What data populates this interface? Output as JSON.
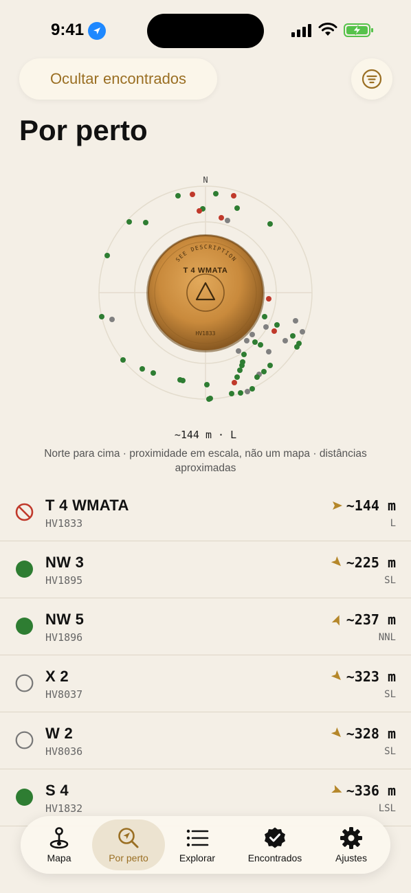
{
  "status_bar": {
    "time": "9:41"
  },
  "header": {
    "hide_found_label": "Ocultar encontrados",
    "title": "Por perto"
  },
  "radar": {
    "north_label": "N",
    "medallion_top_text": "SEE DESCRIPTION",
    "medallion_name": "T 4 WMATA",
    "medallion_code": "HV1833",
    "distance_summary": "~144 m · L",
    "note": "Norte para cima · proximidade em escala, não um mapa · distâncias aproximadas"
  },
  "list": [
    {
      "name": "T 4 WMATA",
      "code": "HV1833",
      "distance": "~144 m",
      "direction": "L",
      "status": "destroyed",
      "bearing": 90
    },
    {
      "name": "NW 3",
      "code": "HV1895",
      "distance": "~225 m",
      "direction": "SL",
      "status": "found",
      "bearing": 135
    },
    {
      "name": "NW 5",
      "code": "HV1896",
      "distance": "~237 m",
      "direction": "NNL",
      "status": "found",
      "bearing": 22
    },
    {
      "name": "X 2",
      "code": "HV8037",
      "distance": "~323 m",
      "direction": "SL",
      "status": "not-found",
      "bearing": 135
    },
    {
      "name": "W 2",
      "code": "HV8036",
      "distance": "~328 m",
      "direction": "SL",
      "status": "not-found",
      "bearing": 135
    },
    {
      "name": "S 4",
      "code": "HV1832",
      "distance": "~336 m",
      "direction": "LSL",
      "status": "found",
      "bearing": 112
    }
  ],
  "tabs": [
    {
      "label": "Mapa",
      "icon": "map-pin-icon"
    },
    {
      "label": "Por perto",
      "icon": "nearby-search-icon",
      "active": true
    },
    {
      "label": "Explorar",
      "icon": "list-icon"
    },
    {
      "label": "Encontrados",
      "icon": "verified-badge-icon"
    },
    {
      "label": "Ajustes",
      "icon": "gear-icon"
    }
  ],
  "colors": {
    "background": "#f4efe6",
    "accent": "#9a6f23",
    "found": "#2e7d32",
    "destroyed": "#c0392b",
    "not_found": "#777777"
  }
}
